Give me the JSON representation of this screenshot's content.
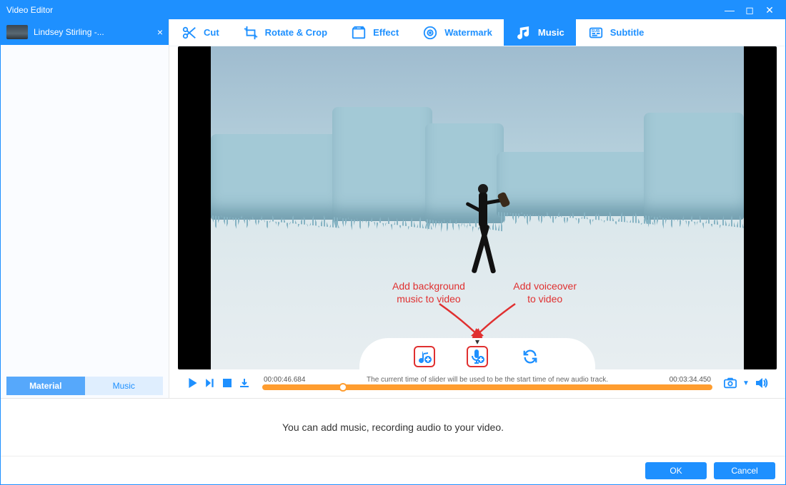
{
  "window": {
    "title": "Video Editor"
  },
  "sidebar": {
    "file_name": "Lindsey Stirling -...",
    "tabs": {
      "material": "Material",
      "music": "Music"
    }
  },
  "toolbar": {
    "cut": "Cut",
    "rotate_crop": "Rotate & Crop",
    "effect": "Effect",
    "watermark": "Watermark",
    "music": "Music",
    "subtitle": "Subtitle"
  },
  "annotations": {
    "add_bg_music_l1": "Add background",
    "add_bg_music_l2": "music to video",
    "add_voiceover_l1": "Add voiceover",
    "add_voiceover_l2": "to video"
  },
  "timeline": {
    "current": "00:00:46.684",
    "hint": "The current time of slider will be used to be the start time of new audio track.",
    "total": "00:03:34.450"
  },
  "info_text": "You can add music, recording audio to your video.",
  "footer": {
    "ok": "OK",
    "cancel": "Cancel"
  }
}
